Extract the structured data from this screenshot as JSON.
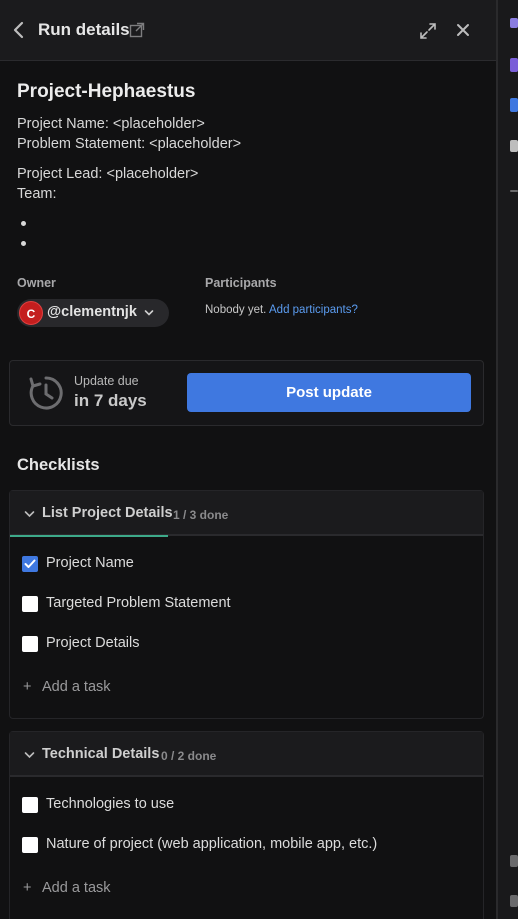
{
  "header": {
    "title": "Run details"
  },
  "run": {
    "name": "Project-Hephaestus",
    "description_lines": [
      "Project Name: <placeholder>",
      "Problem Statement: <placeholder>",
      "Project Lead: <placeholder>",
      "Team:"
    ]
  },
  "owner": {
    "label": "Owner",
    "avatar_letter": "C",
    "username": "@clementnjk"
  },
  "participants": {
    "label": "Participants",
    "empty_text": "Nobody yet.",
    "add_link": "Add participants?"
  },
  "update": {
    "due_label": "Update due",
    "due_value": "in 7 days",
    "post_button": "Post update"
  },
  "checklists": {
    "heading": "Checklists",
    "add_task_label": "Add a task",
    "lists": [
      {
        "title": "List Project Details",
        "count": "1 / 3 done",
        "progress": 0.333,
        "tasks": [
          {
            "label": "Project Name",
            "checked": true
          },
          {
            "label": "Targeted Problem Statement",
            "checked": false
          },
          {
            "label": "Project Details",
            "checked": false
          }
        ]
      },
      {
        "title": "Technical Details",
        "count": "0 / 2 done",
        "progress": 0,
        "tasks": [
          {
            "label": "Technologies to use",
            "checked": false
          },
          {
            "label": "Nature of project (web application, mobile app, etc.)",
            "checked": false
          }
        ]
      }
    ]
  },
  "colors": {
    "accent": "#3f78e0",
    "progress": "#3daa8a",
    "link": "#5b9cf0",
    "avatar": "#c41e1e"
  }
}
